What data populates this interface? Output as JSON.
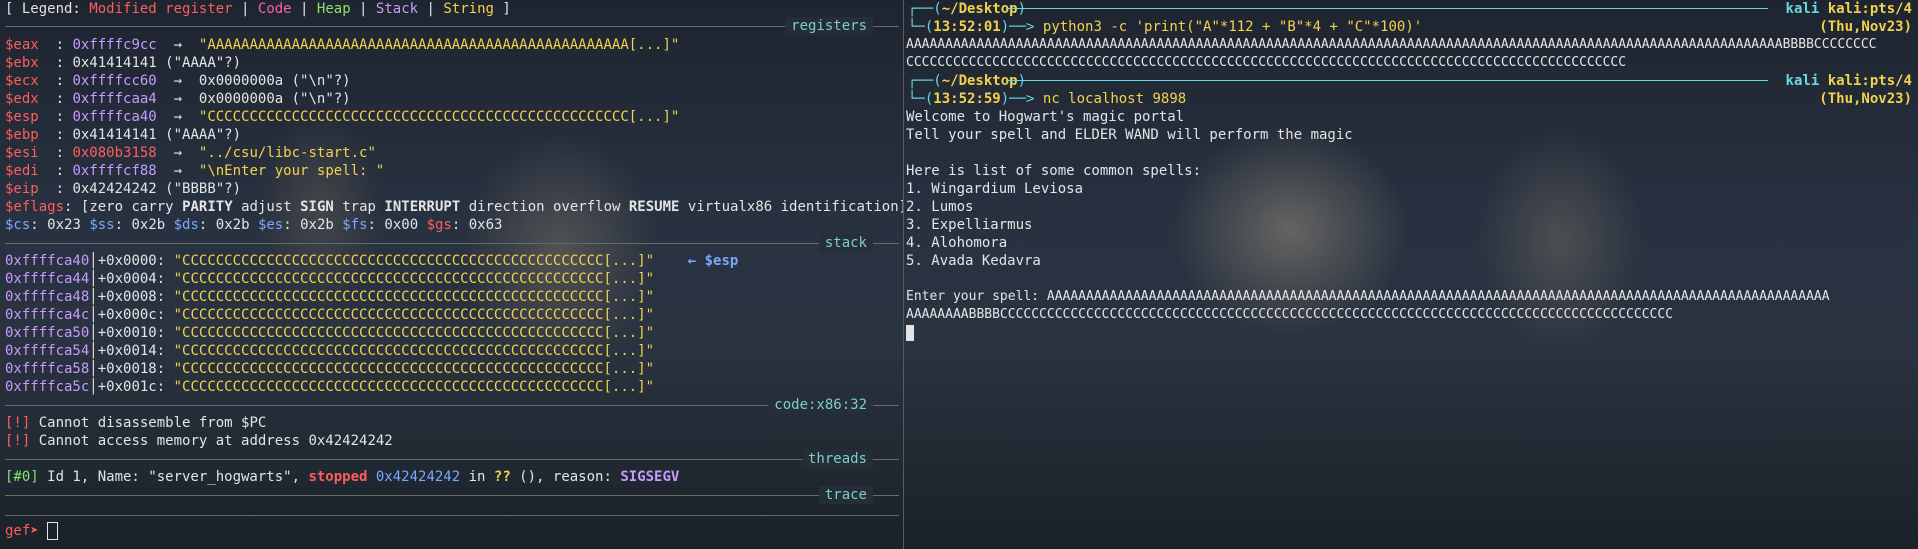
{
  "legend": {
    "prefix": "[ Legend: ",
    "modified": "Modified register",
    "code": "Code",
    "heap": "Heap",
    "stack": "Stack",
    "string": "String",
    "suffix": " ]",
    "divider": " | "
  },
  "sections": {
    "registers": "registers",
    "stack": "stack",
    "code": "code:x86:32",
    "threads": "threads",
    "trace": "trace"
  },
  "registers": [
    {
      "name": "$eax",
      "sep": "  : ",
      "value": "0xffffc9cc",
      "arrow": "  →  ",
      "deref": "\"AAAAAAAAAAAAAAAAAAAAAAAAAAAAAAAAAAAAAAAAAAAAAAAAAA[...]\""
    },
    {
      "name": "$ebx",
      "sep": "  : ",
      "value": "0x41414141",
      "arrow": " ",
      "deref": "(\"AAAA\"?)"
    },
    {
      "name": "$ecx",
      "sep": "  : ",
      "value": "0xffffcc60",
      "arrow": "  →  ",
      "deref": "0x0000000a (\"\\n\"?)"
    },
    {
      "name": "$edx",
      "sep": "  : ",
      "value": "0xffffcaa4",
      "arrow": "  →  ",
      "deref": "0x0000000a (\"\\n\"?)"
    },
    {
      "name": "$esp",
      "sep": "  : ",
      "value": "0xffffca40",
      "arrow": "  →  ",
      "deref": "\"CCCCCCCCCCCCCCCCCCCCCCCCCCCCCCCCCCCCCCCCCCCCCCCCCC[...]\""
    },
    {
      "name": "$ebp",
      "sep": "  : ",
      "value": "0x41414141",
      "arrow": " ",
      "deref": "(\"AAAA\"?)"
    },
    {
      "name": "$esi",
      "sep": "  : ",
      "value": "0x080b3158",
      "arrow": "  →  ",
      "deref": "\"../csu/libc-start.c\""
    },
    {
      "name": "$edi",
      "sep": "  : ",
      "value": "0xffffcf88",
      "arrow": "  →  ",
      "deref": "\"\\nEnter your spell: \""
    },
    {
      "name": "$eip",
      "sep": "  : ",
      "value": "0x42424242",
      "arrow": " ",
      "deref": "(\"BBBB\"?)"
    }
  ],
  "eflags": {
    "name": "$eflags",
    "sep": ": ",
    "open": "[",
    "flags": [
      {
        "text": "zero",
        "bold": false
      },
      {
        "text": "carry",
        "bold": false
      },
      {
        "text": "PARITY",
        "bold": true
      },
      {
        "text": "adjust",
        "bold": false
      },
      {
        "text": "SIGN",
        "bold": true
      },
      {
        "text": "trap",
        "bold": false
      },
      {
        "text": "INTERRUPT",
        "bold": true
      },
      {
        "text": "direction",
        "bold": false
      },
      {
        "text": "overflow",
        "bold": false
      },
      {
        "text": "RESUME",
        "bold": true
      },
      {
        "text": "virtualx86",
        "bold": false
      },
      {
        "text": "identification",
        "bold": false
      }
    ],
    "close": "]"
  },
  "segments": [
    {
      "name": "$cs",
      "value": "0x23",
      "red": false
    },
    {
      "name": "$ss",
      "value": "0x2b",
      "red": false
    },
    {
      "name": "$ds",
      "value": "0x2b",
      "red": false
    },
    {
      "name": "$es",
      "value": "0x2b",
      "red": false
    },
    {
      "name": "$fs",
      "value": "0x00",
      "red": false
    },
    {
      "name": "$gs",
      "value": "0x63",
      "red": true
    }
  ],
  "stack": [
    {
      "addr": "0xffffca40",
      "off": "+0x0000",
      "val": "\"CCCCCCCCCCCCCCCCCCCCCCCCCCCCCCCCCCCCCCCCCCCCCCCCCC[...]\"",
      "tag": "← $esp"
    },
    {
      "addr": "0xffffca44",
      "off": "+0x0004",
      "val": "\"CCCCCCCCCCCCCCCCCCCCCCCCCCCCCCCCCCCCCCCCCCCCCCCCCC[...]\"",
      "tag": ""
    },
    {
      "addr": "0xffffca48",
      "off": "+0x0008",
      "val": "\"CCCCCCCCCCCCCCCCCCCCCCCCCCCCCCCCCCCCCCCCCCCCCCCCCC[...]\"",
      "tag": ""
    },
    {
      "addr": "0xffffca4c",
      "off": "+0x000c",
      "val": "\"CCCCCCCCCCCCCCCCCCCCCCCCCCCCCCCCCCCCCCCCCCCCCCCCCC[...]\"",
      "tag": ""
    },
    {
      "addr": "0xffffca50",
      "off": "+0x0010",
      "val": "\"CCCCCCCCCCCCCCCCCCCCCCCCCCCCCCCCCCCCCCCCCCCCCCCCCC[...]\"",
      "tag": ""
    },
    {
      "addr": "0xffffca54",
      "off": "+0x0014",
      "val": "\"CCCCCCCCCCCCCCCCCCCCCCCCCCCCCCCCCCCCCCCCCCCCCCCCCC[...]\"",
      "tag": ""
    },
    {
      "addr": "0xffffca58",
      "off": "+0x0018",
      "val": "\"CCCCCCCCCCCCCCCCCCCCCCCCCCCCCCCCCCCCCCCCCCCCCCCCCC[...]\"",
      "tag": ""
    },
    {
      "addr": "0xffffca5c",
      "off": "+0x001c",
      "val": "\"CCCCCCCCCCCCCCCCCCCCCCCCCCCCCCCCCCCCCCCCCCCCCCCCCC[...]\"",
      "tag": ""
    }
  ],
  "code_msgs": [
    {
      "tag": "[!]",
      "text": " Cannot disassemble from $PC"
    },
    {
      "tag": "[!]",
      "text": " Cannot access memory at address 0x42424242"
    }
  ],
  "thread": {
    "id": "[#0]",
    "text1": " Id 1, Name: \"server_hogwarts\", ",
    "stopped": "stopped",
    "addr": " 0x42424242",
    "in": " in ",
    "func": "??",
    "text2": " (), reason: ",
    "reason": "SIGSEGV"
  },
  "gef_prompt": "gef➤ ",
  "colors": {
    "modified": "#ff5d5d",
    "code": "#ff5fa0",
    "heap": "#89e36b",
    "stack": "#c79bff",
    "string": "#f3d24c",
    "section": "#7ccfc6",
    "address": "#7aa7ff",
    "prompt": "#6ad7e0"
  },
  "right": {
    "prompt1": {
      "top_open": "┌──(",
      "cwd": "~/Desktop",
      "top_close": ")",
      "host": "kali",
      "tty": "kali:pts/4",
      "bot_open": "└─(",
      "time": "13:52:01",
      "bot_close": ")──> ",
      "cmd": "python3 -c 'print(\"A\"*112 + \"B\"*4 + \"C\"*100)'",
      "date": "(Thu,Nov23)"
    },
    "out1_line1": "AAAAAAAAAAAAAAAAAAAAAAAAAAAAAAAAAAAAAAAAAAAAAAAAAAAAAAAAAAAAAAAAAAAAAAAAAAAAAAAAAAAAAAAAAAAAAAAAAAAAAAAAAAAAAAAABBBBCCCCCCCC",
    "out1_line2": "CCCCCCCCCCCCCCCCCCCCCCCCCCCCCCCCCCCCCCCCCCCCCCCCCCCCCCCCCCCCCCCCCCCCCCCCCCCCCCCCCCCCCCCCCCCC",
    "prompt2": {
      "top_open": "┌──(",
      "cwd": "~/Desktop",
      "top_close": ")",
      "host": "kali",
      "tty": "kali:pts/4",
      "bot_open": "└─(",
      "time": "13:52:59",
      "bot_close": ")──> ",
      "cmd": "nc localhost 9898",
      "date": "(Thu,Nov23)"
    },
    "welcome": "Welcome to Hogwart's magic portal",
    "tell": "Tell your spell and ELDER WAND will perform the magic",
    "list_header": "Here is list of some common spells:",
    "spells": [
      "1. Wingardium Leviosa",
      "2. Lumos",
      "3. Expelliarmus",
      "4. Alohomora",
      "5. Avada Kedavra"
    ],
    "enter_line1": "Enter your spell: AAAAAAAAAAAAAAAAAAAAAAAAAAAAAAAAAAAAAAAAAAAAAAAAAAAAAAAAAAAAAAAAAAAAAAAAAAAAAAAAAAAAAAAAAAAAAAAAAAAA",
    "enter_line2": "AAAAAAAABBBBCCCCCCCCCCCCCCCCCCCCCCCCCCCCCCCCCCCCCCCCCCCCCCCCCCCCCCCCCCCCCCCCCCCCCCCCCCCCCCCCCCCCCC"
  }
}
